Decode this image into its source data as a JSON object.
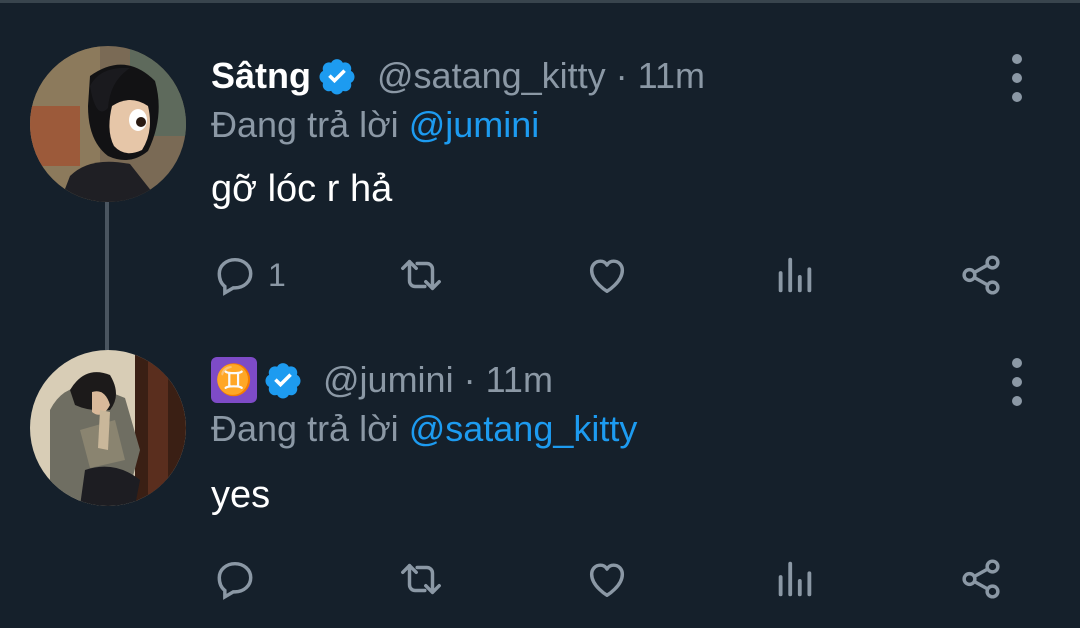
{
  "tweets": [
    {
      "display_name": "Sâtng",
      "handle": "@satang_kitty",
      "time": "· 11m",
      "replying_prefix": "Đang trả lời",
      "replying_to": "@jumini",
      "text": "gỡ lóc r hả",
      "reply_count": "1",
      "verified": true,
      "avatar": "animated-girl-black-hair-avatar"
    },
    {
      "display_name": "♊",
      "handle": "@jumini",
      "time": "· 11m",
      "replying_prefix": "Đang trả lời",
      "replying_to": "@satang_kitty",
      "text": "yes",
      "reply_count": "",
      "verified": true,
      "avatar": "person-in-jacket-photo-avatar"
    }
  ],
  "colors": {
    "background": "#15202b",
    "muted": "#8b98a5",
    "accent": "#1d9bf0",
    "text": "#ffffff"
  },
  "icons": [
    "reply-icon",
    "retweet-icon",
    "like-icon",
    "analytics-icon",
    "share-icon",
    "more-icon",
    "verified-icon"
  ]
}
